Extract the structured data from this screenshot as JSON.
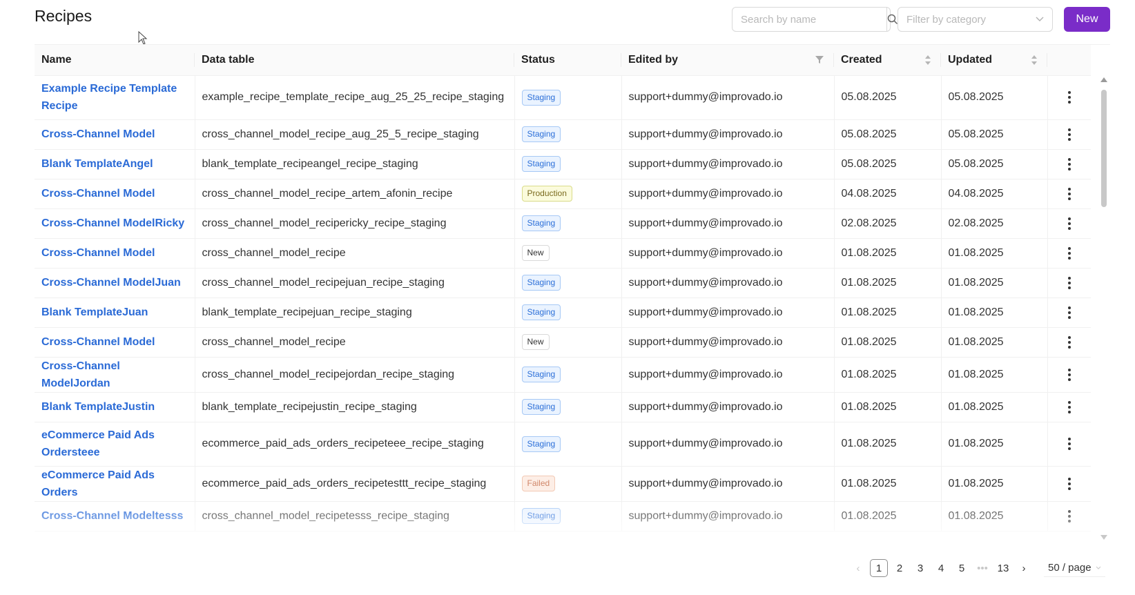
{
  "page": {
    "title": "Recipes"
  },
  "toolbar": {
    "search_placeholder": "Search by name",
    "filter_placeholder": "Filter by category",
    "new_label": "New"
  },
  "table": {
    "headers": {
      "name": "Name",
      "data_table": "Data table",
      "status": "Status",
      "edited_by": "Edited by",
      "created": "Created",
      "updated": "Updated"
    },
    "rows": [
      {
        "name": "Example Recipe Template Recipe",
        "data_table": "example_recipe_template_recipe_aug_25_25_recipe_staging",
        "status": "Staging",
        "status_type": "staging",
        "edited_by": "support+dummy@improvado.io",
        "created": "05.08.2025",
        "updated": "05.08.2025"
      },
      {
        "name": "Cross-Channel Model",
        "data_table": "cross_channel_model_recipe_aug_25_5_recipe_staging",
        "status": "Staging",
        "status_type": "staging",
        "edited_by": "support+dummy@improvado.io",
        "created": "05.08.2025",
        "updated": "05.08.2025"
      },
      {
        "name": "Blank TemplateAngel",
        "data_table": "blank_template_recipeangel_recipe_staging",
        "status": "Staging",
        "status_type": "staging",
        "edited_by": "support+dummy@improvado.io",
        "created": "05.08.2025",
        "updated": "05.08.2025"
      },
      {
        "name": "Cross-Channel Model",
        "data_table": "cross_channel_model_recipe_artem_afonin_recipe",
        "status": "Production",
        "status_type": "production",
        "edited_by": "support+dummy@improvado.io",
        "created": "04.08.2025",
        "updated": "04.08.2025"
      },
      {
        "name": "Cross-Channel ModelRicky",
        "data_table": "cross_channel_model_recipericky_recipe_staging",
        "status": "Staging",
        "status_type": "staging",
        "edited_by": "support+dummy@improvado.io",
        "created": "02.08.2025",
        "updated": "02.08.2025"
      },
      {
        "name": "Cross-Channel Model",
        "data_table": "cross_channel_model_recipe",
        "status": "New",
        "status_type": "new",
        "edited_by": "support+dummy@improvado.io",
        "created": "01.08.2025",
        "updated": "01.08.2025"
      },
      {
        "name": "Cross-Channel ModelJuan",
        "data_table": "cross_channel_model_recipejuan_recipe_staging",
        "status": "Staging",
        "status_type": "staging",
        "edited_by": "support+dummy@improvado.io",
        "created": "01.08.2025",
        "updated": "01.08.2025"
      },
      {
        "name": "Blank TemplateJuan",
        "data_table": "blank_template_recipejuan_recipe_staging",
        "status": "Staging",
        "status_type": "staging",
        "edited_by": "support+dummy@improvado.io",
        "created": "01.08.2025",
        "updated": "01.08.2025"
      },
      {
        "name": "Cross-Channel Model",
        "data_table": "cross_channel_model_recipe",
        "status": "New",
        "status_type": "new",
        "edited_by": "support+dummy@improvado.io",
        "created": "01.08.2025",
        "updated": "01.08.2025"
      },
      {
        "name": "Cross-Channel ModelJordan",
        "data_table": "cross_channel_model_recipejordan_recipe_staging",
        "status": "Staging",
        "status_type": "staging",
        "edited_by": "support+dummy@improvado.io",
        "created": "01.08.2025",
        "updated": "01.08.2025"
      },
      {
        "name": "Blank TemplateJustin",
        "data_table": "blank_template_recipejustin_recipe_staging",
        "status": "Staging",
        "status_type": "staging",
        "edited_by": "support+dummy@improvado.io",
        "created": "01.08.2025",
        "updated": "01.08.2025"
      },
      {
        "name": "eCommerce Paid Ads Ordersteee",
        "data_table": "ecommerce_paid_ads_orders_recipeteee_recipe_staging",
        "status": "Staging",
        "status_type": "staging",
        "edited_by": "support+dummy@improvado.io",
        "created": "01.08.2025",
        "updated": "01.08.2025"
      },
      {
        "name": "eCommerce Paid Ads Orders",
        "data_table": "ecommerce_paid_ads_orders_recipetesttt_recipe_staging",
        "status": "Failed",
        "status_type": "failed",
        "edited_by": "support+dummy@improvado.io",
        "created": "01.08.2025",
        "updated": "01.08.2025"
      },
      {
        "name": "Cross-Channel Modeltesss",
        "data_table": "cross_channel_model_recipetesss_recipe_staging",
        "status": "Staging",
        "status_type": "staging",
        "edited_by": "support+dummy@improvado.io",
        "created": "01.08.2025",
        "updated": "01.08.2025"
      }
    ]
  },
  "pagination": {
    "pages": [
      "1",
      "2",
      "3",
      "4",
      "5"
    ],
    "ellipsis": "•••",
    "last_page": "13",
    "current": "1",
    "page_size": "50 / page"
  },
  "icons": {
    "search": "search-icon",
    "chevron": "chevron-down-icon",
    "filter": "filter-icon",
    "sort": "sort-icon",
    "more": "more-vertical-icon"
  },
  "colors": {
    "accent": "#7a2cc8",
    "link": "#2a6ad6"
  }
}
